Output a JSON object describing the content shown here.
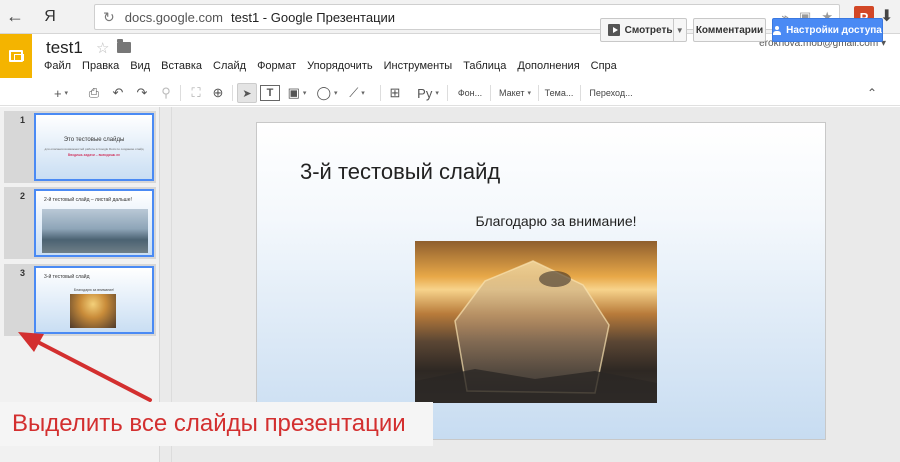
{
  "browser": {
    "back_icon": "←",
    "ya_label": "Я",
    "refresh_icon": "↻",
    "domain": "docs.google.com",
    "page_title": "test1 - Google Презентации",
    "ppt_label": "P",
    "download_icon": "⬇"
  },
  "doc": {
    "title": "test1",
    "star_icon": "☆",
    "account": "erokhova.mob@gmail.com ▾",
    "menu": [
      "Файл",
      "Правка",
      "Вид",
      "Вставка",
      "Слайд",
      "Формат",
      "Упорядочить",
      "Инструменты",
      "Таблица",
      "Дополнения",
      "Спра"
    ],
    "watch_label": "Смотреть",
    "comments_label": "Комментарии",
    "share_label": "Настройки доступа"
  },
  "toolbar": {
    "add": "+",
    "print": "⎙",
    "undo": "↶",
    "redo": "↷",
    "paint": "⚲",
    "fit": "⛶",
    "zoom": "⊕",
    "select": "➤",
    "textbox": "T",
    "image": "▣",
    "shape": "◯",
    "line": "⟋",
    "comment": "⊞",
    "input_tools": "Ру",
    "background": "Фон...",
    "layout": "Макет",
    "theme": "Тема...",
    "transition": "Переход...",
    "collapse": "⌃"
  },
  "slides": [
    {
      "number": "1",
      "title": "Это тестовые слайды",
      "subtitle": "для описания возможностей работы в Google Docs по созданию слайд",
      "link": "Вводишь задачи – выводишь их"
    },
    {
      "number": "2",
      "title": "2-й тестовый слайд – листай дальше!"
    },
    {
      "number": "3",
      "title": "3-й тестовый слайд",
      "subtitle": "Благодарю за внимание!"
    }
  ],
  "current_slide": {
    "title": "3-й тестовый слайд",
    "text": "Благодарю за внимание!"
  },
  "annotation": {
    "text": "Выделить все слайды презентации",
    "color": "#d32f2f"
  }
}
